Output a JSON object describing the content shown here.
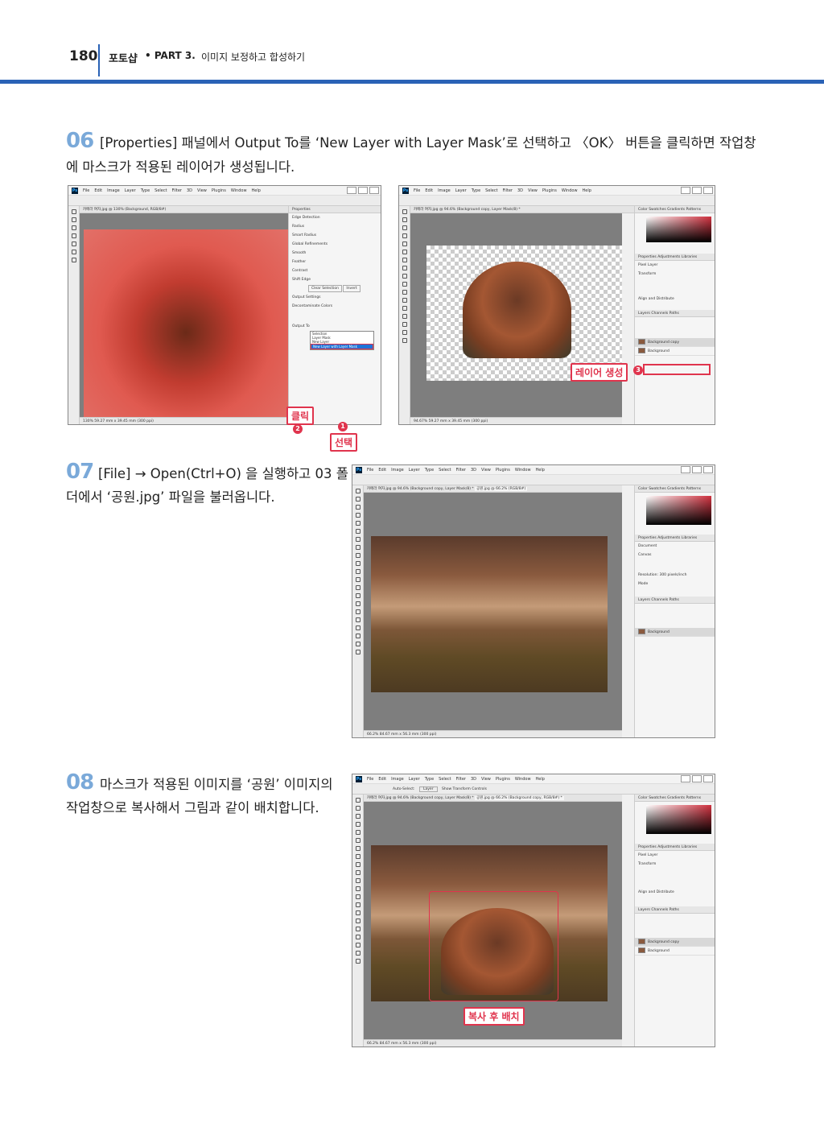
{
  "header": {
    "page_number": "180",
    "book": "포토샵",
    "part": "• PART 3.",
    "chapter": "이미지 보정하고 합성하기"
  },
  "steps": [
    {
      "number": "06",
      "text_line1": "[Properties] 패널에서 Output To를 ‘New Layer with Layer Mask’로 선택하고 〈OK〉 버튼을 클릭하면 작업창",
      "text_line2": "에 마스크가 적용된 레이어가 생성됩니다."
    },
    {
      "number": "07",
      "text_line1": "[File] → Open(Ctrl+O) 을 실행하고 03 폴",
      "text_line2": "더에서 ‘공원.jpg’ 파일을 불러옵니다."
    },
    {
      "number": "08",
      "text_line1": "마스크가 적용된 이미지를 ‘공원’ 이미지의",
      "text_line2": "작업창으로 복사해서 그림과 같이 배치합니다."
    }
  ],
  "ps_menu": [
    "File",
    "Edit",
    "Image",
    "Layer",
    "Type",
    "Select",
    "Filter",
    "3D",
    "View",
    "Plugins",
    "Window",
    "Help"
  ],
  "shot1": {
    "tab": "카메라 여자.jpg @ 130% (Background, RGB/8#)",
    "status": "130%   59.27 mm x 39.45 mm (300 ppi)",
    "panel_title": "Properties",
    "rows": [
      "Edge Detection",
      "Radius",
      "Smart Radius",
      "Global Refinements",
      "Smooth",
      "Feather",
      "Contrast",
      "Shift Edge",
      "Clear Selection",
      "Invert",
      "Output Settings",
      "Decontaminate Colors",
      "Output To"
    ],
    "dropdown": [
      "Selection",
      "Layer Mask",
      "New Layer",
      "New Layer with Layer Mask"
    ],
    "callout_click": "클릭",
    "callout_select": "선택",
    "badge1": "1",
    "badge2": "2"
  },
  "shot2": {
    "tab": "카메라 여자.jpg @ 94.6% (Background copy, Layer Mask/8) *",
    "status": "94.67%   59.27 mm x 39.45 mm (300 ppi)",
    "panels": [
      "Color",
      "Swatches",
      "Gradients",
      "Patterns"
    ],
    "props": [
      "Properties",
      "Adjustments",
      "Libraries"
    ],
    "pixel_layer": "Pixel Layer",
    "transform": "Transform",
    "align": "Align and Distribute",
    "layers_tabs": [
      "Layers",
      "Channels",
      "Paths"
    ],
    "layer1": "Background copy",
    "layer2": "Background",
    "callout": "레이어 생성",
    "badge": "3"
  },
  "shot3": {
    "tab1": "카메라 여자.jpg @ 94.6% (Background copy, Layer Mask/8) *",
    "tab2": "공원.jpg @ 66.2% (RGB/8#)",
    "status": "66.2%   84.67 mm x 56.3 mm (300 ppi)",
    "doc": "Document",
    "canvas": "Canvas",
    "resolution": "Resolution: 300 pixels/inch",
    "mode": "Mode",
    "layer": "Background"
  },
  "shot4": {
    "tab1": "카메라 여자.jpg @ 94.6% (Background copy, Layer Mask/8) *",
    "tab2": "공원.jpg @ 66.2% (Background copy, RGB/8#) *",
    "status": "66.2%   84.67 mm x 56.3 mm (300 ppi)",
    "pixel_layer": "Pixel Layer",
    "transform": "Transform",
    "align": "Align and Distribute",
    "layer1": "Background copy",
    "layer2": "Background",
    "callout": "복사 후 배치",
    "opt_autoselect": "Auto-Select:",
    "opt_layer": "Layer",
    "opt_transform": "Show Transform Controls"
  },
  "colors": {
    "accent": "#2a62b6",
    "callout": "#e0344d",
    "step_number": "#7aa9d9"
  }
}
